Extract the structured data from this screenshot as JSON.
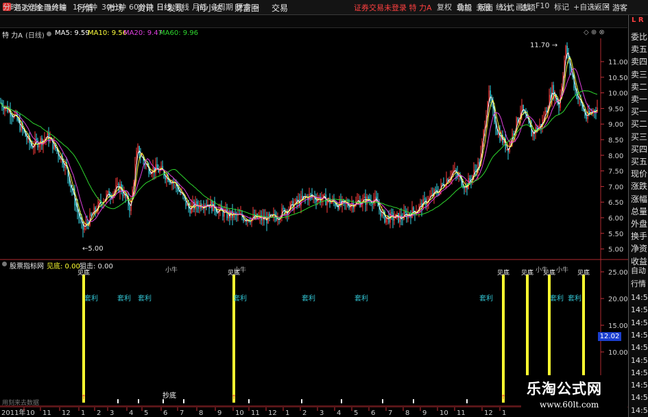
{
  "titlebar": {
    "app_title": "通达信金融终端",
    "menus": [
      "行情",
      "市场",
      "资讯",
      "发现",
      "问小达",
      "财富圈",
      "交易"
    ],
    "warning": "证券交易未登录  特 力A",
    "right_menus": [
      "功能",
      "版面",
      "公式",
      "选项"
    ],
    "guest": "游客"
  },
  "toolbar": {
    "periods": [
      "分时",
      "1分钟",
      "5分钟",
      "15分钟",
      "30分钟",
      "60分钟",
      "日线",
      "周线",
      "月线",
      "多周期",
      "更多 >"
    ],
    "active_period": "日线",
    "right_buttons": [
      "复权",
      "叠加",
      "多股",
      "统计",
      "画线",
      "F10",
      "标记",
      "+自选",
      "返回"
    ]
  },
  "info": {
    "stock": "特 力A",
    "period": "(日线)",
    "ma5": "MA5: 9.59",
    "ma10": "MA10: 9.56",
    "ma20": "MA20: 9.47",
    "ma60": "MA60: 9.96"
  },
  "price_axis": {
    "labels": [
      "11.00",
      "10.50",
      "10.00",
      "9.50",
      "9.00",
      "8.50",
      "8.00",
      "7.50",
      "7.00",
      "6.50",
      "6.00",
      "5.50",
      "5.00"
    ],
    "high_label": "11.70",
    "low_label": "5.00"
  },
  "indicator": {
    "name": "股票指标网",
    "jiandi": "见底: 0.00",
    "zuji": "狙击: 0.00",
    "axis": [
      "25.00",
      "20.00",
      "15.00",
      "10.00",
      "5.00"
    ],
    "current": "12.02",
    "signal_top": "见底",
    "signal_mid": "小牛",
    "profit_label": "套利",
    "bottom_label": "抄底",
    "bottom_left": "用刻来去数据"
  },
  "time_axis": {
    "year": "2011年",
    "months": [
      "10",
      "11",
      "12",
      "1",
      "2",
      "3",
      "4",
      "5",
      "6",
      "7",
      "8",
      "9",
      "10",
      "11",
      "12",
      "1",
      "2",
      "3",
      "4",
      "5",
      "6",
      "7",
      "8",
      "9",
      "10",
      "11",
      "12",
      "1"
    ]
  },
  "right_panel": {
    "quote_labels": [
      "委比",
      "卖五",
      "卖四",
      "卖三",
      "卖二",
      "卖一",
      "买一",
      "买二",
      "买三",
      "买四",
      "买五",
      "现价",
      "涨跌",
      "涨幅",
      "总量",
      "外盘",
      "换手",
      "净资",
      "收益"
    ],
    "lower_labels": [
      "自动",
      "行情"
    ],
    "times": [
      "14:5",
      "14:5",
      "14:5",
      "14:5",
      "14:5",
      "14:5",
      "14:5",
      "14:5",
      "14:5",
      "14:5"
    ],
    "corner": "L R"
  },
  "watermark": {
    "cn": "乐淘公式网",
    "url": "www.60lt.com"
  },
  "colors": {
    "up": "#ff3b3b",
    "down": "#38d8e8",
    "ma5": "#ffffff",
    "ma10": "#ffff3c",
    "ma20": "#e040e0",
    "ma60": "#2ed82e",
    "signal": "#ffff30",
    "profit": "#33c7d6",
    "axis": "#c8323a"
  }
}
